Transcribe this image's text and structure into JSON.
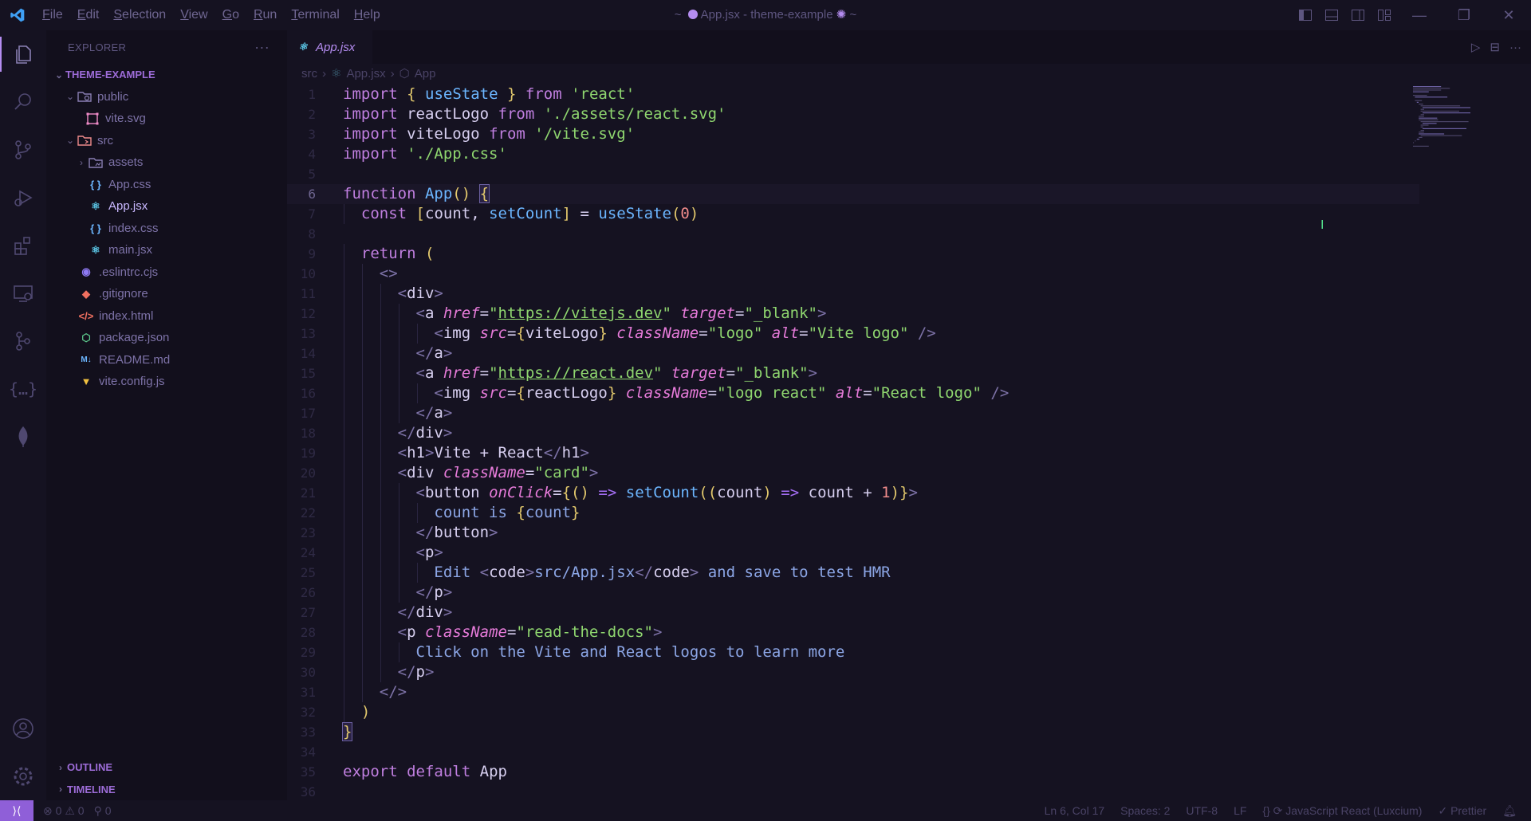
{
  "titlebar": {
    "menu": [
      "File",
      "Edit",
      "Selection",
      "View",
      "Go",
      "Run",
      "Terminal",
      "Help"
    ],
    "title_prefix": "~",
    "title": "App.jsx - theme-example",
    "title_suffix": "~"
  },
  "sidebar": {
    "header": "EXPLORER",
    "root": "THEME-EXAMPLE",
    "items": [
      {
        "label": "public",
        "type": "folder",
        "open": true,
        "icon": "folder-public-icon"
      },
      {
        "label": "vite.svg",
        "type": "file",
        "icon": "svg-file-icon"
      },
      {
        "label": "src",
        "type": "folder",
        "open": true,
        "icon": "folder-src-icon"
      },
      {
        "label": "assets",
        "type": "folder",
        "open": false,
        "icon": "folder-assets-icon"
      },
      {
        "label": "App.css",
        "type": "file",
        "icon": "css-file-icon"
      },
      {
        "label": "App.jsx",
        "type": "file",
        "icon": "react-file-icon"
      },
      {
        "label": "index.css",
        "type": "file",
        "icon": "css-file-icon"
      },
      {
        "label": "main.jsx",
        "type": "file",
        "icon": "react-file-icon"
      },
      {
        "label": ".eslintrc.cjs",
        "type": "file",
        "icon": "eslint-file-icon"
      },
      {
        "label": ".gitignore",
        "type": "file",
        "icon": "git-file-icon"
      },
      {
        "label": "index.html",
        "type": "file",
        "icon": "html-file-icon"
      },
      {
        "label": "package.json",
        "type": "file",
        "icon": "node-file-icon"
      },
      {
        "label": "README.md",
        "type": "file",
        "icon": "markdown-file-icon"
      },
      {
        "label": "vite.config.js",
        "type": "file",
        "icon": "vite-file-icon"
      }
    ],
    "outline": "OUTLINE",
    "timeline": "TIMELINE"
  },
  "editor": {
    "tab": "App.jsx",
    "breadcrumb": [
      "src",
      "App.jsx",
      "App"
    ],
    "current_line": 6,
    "code_lines": [
      "import { useState } from 'react'",
      "import reactLogo from './assets/react.svg'",
      "import viteLogo from '/vite.svg'",
      "import './App.css'",
      "",
      "function App() {",
      "  const [count, setCount] = useState(0)",
      "",
      "  return (",
      "    <>",
      "      <div>",
      "        <a href=\"https://vitejs.dev\" target=\"_blank\">",
      "          <img src={viteLogo} className=\"logo\" alt=\"Vite logo\" />",
      "        </a>",
      "        <a href=\"https://react.dev\" target=\"_blank\">",
      "          <img src={reactLogo} className=\"logo react\" alt=\"React logo\" />",
      "        </a>",
      "      </div>",
      "      <h1>Vite + React</h1>",
      "      <div className=\"card\">",
      "        <button onClick={() => setCount((count) => count + 1)}>",
      "          count is {count}",
      "        </button>",
      "        <p>",
      "          Edit <code>src/App.jsx</code> and save to test HMR",
      "        </p>",
      "      </div>",
      "      <p className=\"read-the-docs\">",
      "        Click on the Vite and React logos to learn more",
      "      </p>",
      "    </>",
      "  )",
      "}",
      "",
      "export default App",
      ""
    ]
  },
  "statusbar": {
    "errors": "0",
    "warnings": "0",
    "ports": "0",
    "position": "Ln 6, Col 17",
    "spaces": "Spaces: 2",
    "encoding": "UTF-8",
    "eol": "LF",
    "language": "JavaScript React (Luxcium)",
    "formatter": "Prettier"
  },
  "colors": {
    "background": "#151221",
    "sidebar": "#120f1c",
    "accent": "#b48cf0",
    "remote": "#8f5fd8"
  }
}
